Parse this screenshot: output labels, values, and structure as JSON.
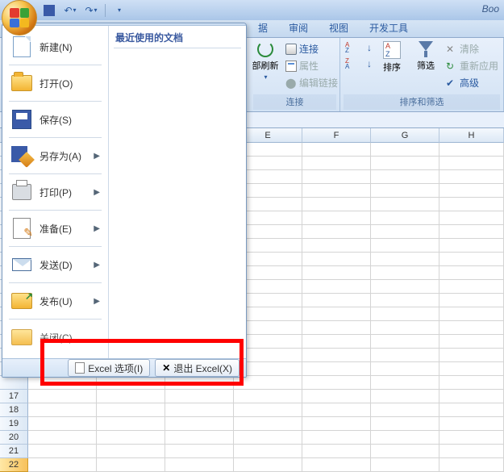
{
  "window": {
    "title_fragment": "Boo"
  },
  "qat": {
    "save": "保存",
    "undo": "撤销",
    "redo": "恢复"
  },
  "ribbon": {
    "tabs": {
      "data_suffix": "据",
      "review": "审阅",
      "view": "视图",
      "developer": "开发工具"
    },
    "groups": {
      "connections": {
        "label": "连接",
        "refresh_suffix": "部刷新",
        "connections": "连接",
        "properties": "属性",
        "edit_links": "编辑链接"
      },
      "sort_filter": {
        "label": "排序和筛选",
        "sort": "排序",
        "filter": "筛选",
        "clear": "清除",
        "reapply": "重新应用",
        "advanced": "高级"
      }
    }
  },
  "columns": [
    "E",
    "F",
    "G",
    "H"
  ],
  "rows": [
    "17",
    "18",
    "19",
    "20",
    "21",
    "22"
  ],
  "selected_row": "22",
  "office_menu": {
    "recent_title": "最近使用的文档",
    "items": {
      "new": {
        "label": "新建(N)",
        "has_arrow": false
      },
      "open": {
        "label": "打开(O)",
        "has_arrow": false
      },
      "save": {
        "label": "保存(S)",
        "has_arrow": false
      },
      "saveas": {
        "label": "另存为(A)",
        "has_arrow": true
      },
      "print": {
        "label": "打印(P)",
        "has_arrow": true
      },
      "prepare": {
        "label": "准备(E)",
        "has_arrow": true
      },
      "send": {
        "label": "发送(D)",
        "has_arrow": true
      },
      "publish": {
        "label": "发布(U)",
        "has_arrow": true
      },
      "close": {
        "label": "关闭(C)",
        "has_arrow": false
      }
    },
    "options_btn": "Excel 选项(I)",
    "exit_btn": "退出 Excel(X)"
  }
}
